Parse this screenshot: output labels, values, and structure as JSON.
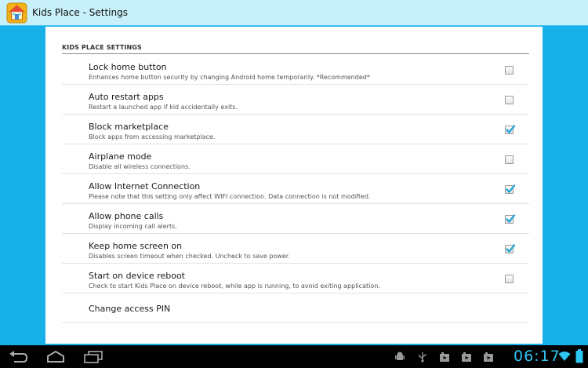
{
  "window": {
    "title": "Kids Place - Settings"
  },
  "section": {
    "header": "KIDS PLACE SETTINGS"
  },
  "settings": [
    {
      "title": "Lock home button",
      "summary": "Enhances home button security by changing Android home temporarily. *Recommended*",
      "checked": false
    },
    {
      "title": "Auto restart apps",
      "summary": "Restart a launched app if kid accidentally exits.",
      "checked": false
    },
    {
      "title": "Block marketplace",
      "summary": "Block apps from accessing marketplace.",
      "checked": true
    },
    {
      "title": "Airplane mode",
      "summary": "Disable all wireless connections.",
      "checked": false
    },
    {
      "title": "Allow Internet Connection",
      "summary": "Please note that this setting only affect WIFI connection. Data connection is not modified.",
      "checked": true
    },
    {
      "title": "Allow phone calls",
      "summary": "Display incoming call alerts.",
      "checked": true
    },
    {
      "title": "Keep home screen on",
      "summary": "Disables screen timeout when checked. Uncheck to save power.",
      "checked": true
    },
    {
      "title": "Start on device reboot",
      "summary": "Check to start Kids Place on device reboot, while app is running, to avoid exiting application.",
      "checked": false
    }
  ],
  "change_pin": {
    "title": "Change access PIN"
  },
  "system_bar": {
    "clock": "06:17",
    "accent": "#2ec6f2",
    "nav_icons": [
      "back-icon",
      "home-icon",
      "recent-apps-icon"
    ],
    "status_icons": [
      "android-debug-icon",
      "usb-icon",
      "media-icon",
      "media-icon",
      "media-icon",
      "wifi-icon",
      "battery-icon"
    ]
  },
  "colors": {
    "accent": "#18b0e8",
    "titlebar": "#c8f0fa",
    "check": "#2aa6d8"
  }
}
